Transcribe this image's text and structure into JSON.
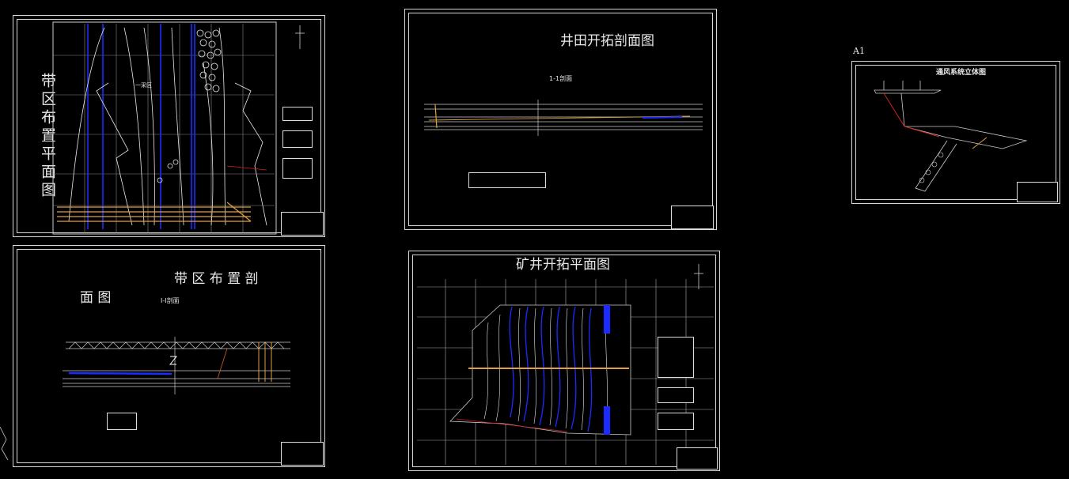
{
  "sheets": {
    "a": {
      "title_vertical": "带区布置平面图",
      "inner_label": "一采区"
    },
    "b": {
      "title_line1": "带 区 布 置 剖",
      "title_line2": "面 图",
      "section_label": "I-I剖面"
    },
    "c": {
      "title": "井田开拓剖面图",
      "section_label": "1-1剖面"
    },
    "d": {
      "title": "矿井开拓平面图"
    },
    "e": {
      "sheet_tag": "A1",
      "title": "通风系统立体图"
    }
  },
  "colors": {
    "background": "#000000",
    "line": "#d8d8d8",
    "blue": "#1a2cff",
    "orange": "#e0a040",
    "red": "#d02020"
  }
}
